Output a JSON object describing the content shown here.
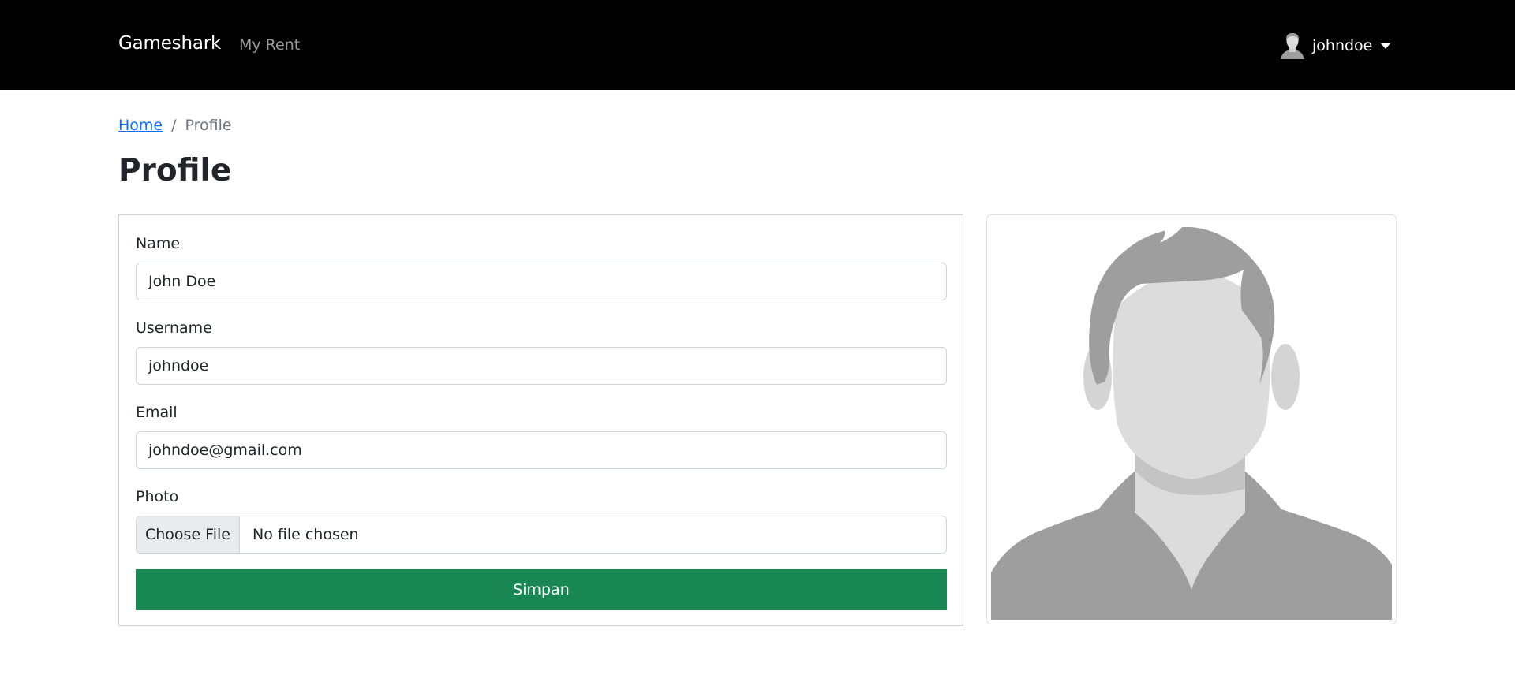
{
  "navbar": {
    "brand": "Gameshark",
    "links": [
      {
        "label": "My Rent"
      }
    ],
    "user": {
      "name": "johndoe",
      "avatar_icon": "user-silhouette-icon",
      "menu_icon": "caret-down-icon"
    }
  },
  "breadcrumb": {
    "home": "Home",
    "separator": "/",
    "current": "Profile"
  },
  "page": {
    "title": "Profile"
  },
  "form": {
    "name": {
      "label": "Name",
      "value": "John Doe"
    },
    "username": {
      "label": "Username",
      "value": "johndoe"
    },
    "email": {
      "label": "Email",
      "value": "johndoe@gmail.com"
    },
    "photo": {
      "label": "Photo",
      "button": "Choose File",
      "status": "No file chosen"
    },
    "submit_label": "Simpan"
  },
  "profile_photo": {
    "icon": "default-avatar-icon"
  },
  "colors": {
    "navbar_bg": "#000000",
    "link": "#0d6efd",
    "submit_bg": "#198754",
    "avatar_hair": "#9e9e9e",
    "avatar_skin": "#dcdcdc"
  }
}
